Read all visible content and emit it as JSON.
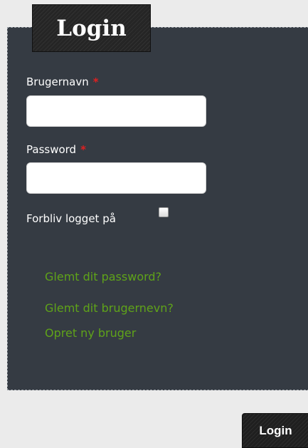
{
  "login_tab": {
    "title": "Login"
  },
  "form": {
    "username_label": "Brugernavn",
    "password_label": "Password",
    "required_marker": "*",
    "username_value": "",
    "password_value": "",
    "remember_label": "Forbliv logget på",
    "remember_checked": false
  },
  "links": {
    "forgot_password": "Glemt dit password?",
    "forgot_username": "Glemt dit brugernevn?",
    "create_user": "Opret ny bruger"
  },
  "submit": {
    "label": "Login"
  },
  "colors": {
    "panel_bg": "#353b43",
    "link": "#5fa319",
    "required": "#e02020",
    "page_bg": "#ebebeb"
  }
}
